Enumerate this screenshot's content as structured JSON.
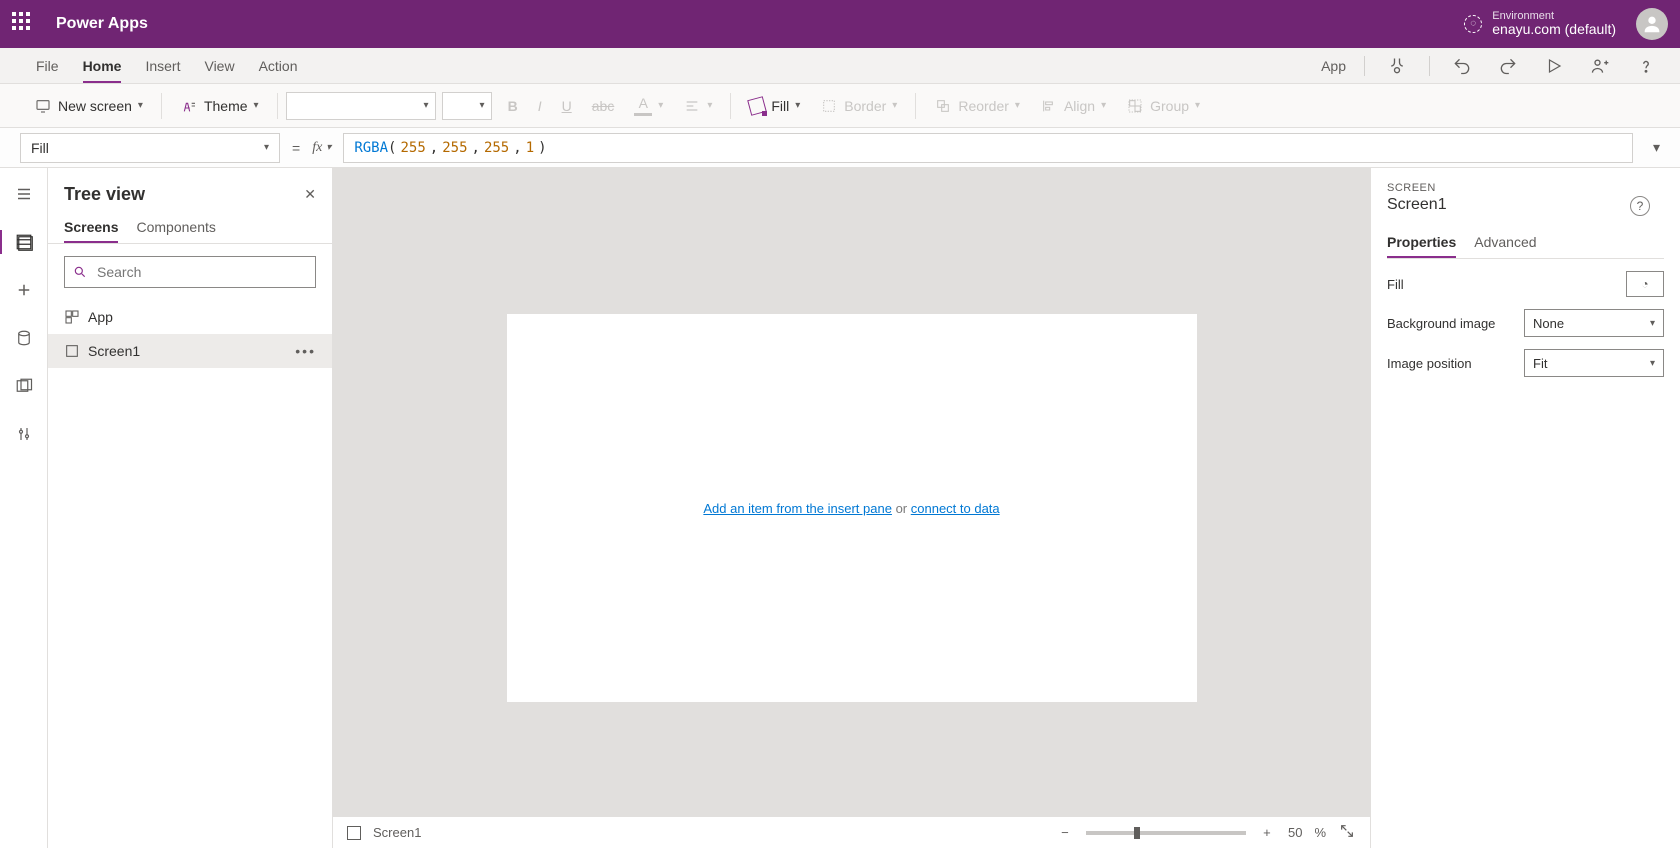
{
  "topbar": {
    "app_name": "Power Apps",
    "env_label": "Environment",
    "env_name": "enayu.com (default)"
  },
  "menubar": {
    "items": [
      "File",
      "Home",
      "Insert",
      "View",
      "Action"
    ],
    "active": "Home",
    "right_app_label": "App"
  },
  "toolbar": {
    "new_screen": "New screen",
    "theme": "Theme",
    "fill": "Fill",
    "border": "Border",
    "reorder": "Reorder",
    "align": "Align",
    "group": "Group"
  },
  "formula": {
    "property": "Fill",
    "fn": "RGBA",
    "args": [
      "255",
      "255",
      "255",
      "1"
    ]
  },
  "treeview": {
    "title": "Tree view",
    "tabs": [
      "Screens",
      "Components"
    ],
    "active_tab": "Screens",
    "search_placeholder": "Search",
    "nodes": [
      {
        "label": "App"
      },
      {
        "label": "Screen1",
        "selected": true
      }
    ]
  },
  "canvas": {
    "hint_link1": "Add an item from the insert pane",
    "hint_mid": " or ",
    "hint_link2": "connect to data"
  },
  "props": {
    "kind": "SCREEN",
    "name": "Screen1",
    "tabs": [
      "Properties",
      "Advanced"
    ],
    "active_tab": "Properties",
    "rows": {
      "fill_label": "Fill",
      "bgimg_label": "Background image",
      "bgimg_value": "None",
      "imgpos_label": "Image position",
      "imgpos_value": "Fit"
    }
  },
  "statusbar": {
    "screen_label": "Screen1",
    "zoom_pct": "50",
    "pct_suffix": "%"
  }
}
